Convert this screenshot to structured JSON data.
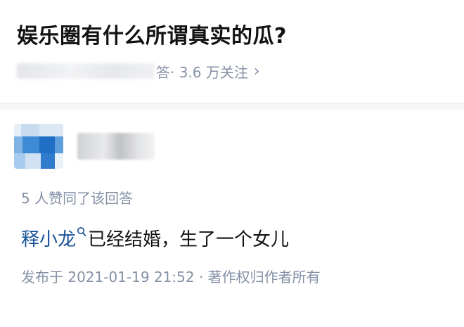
{
  "question": {
    "title": "娱乐圈有什么所谓真实的瓜?",
    "answers_suffix": "答",
    "followers": "· 3.6 万关注",
    "chevron": "›"
  },
  "answer": {
    "voters_text": "5 人赞同了该回答",
    "entity_link": "释小龙",
    "link_icon": "search-icon",
    "content_text": "已经结婚，生了一个女儿",
    "published": "发布于 2021-01-19 21:52 · 著作权归作者所有"
  },
  "colors": {
    "text": "#121212",
    "meta": "#8590a6",
    "link": "#175199",
    "divider": "#f6f6f6"
  }
}
